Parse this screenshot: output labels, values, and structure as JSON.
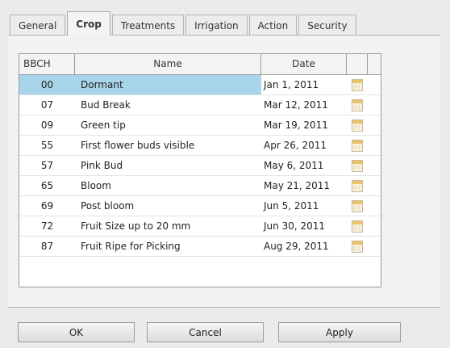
{
  "tabs": [
    {
      "label": "General",
      "active": false
    },
    {
      "label": "Crop",
      "active": true
    },
    {
      "label": "Treatments",
      "active": false
    },
    {
      "label": "Irrigation",
      "active": false
    },
    {
      "label": "Action",
      "active": false
    },
    {
      "label": "Security",
      "active": false
    }
  ],
  "table": {
    "headers": {
      "bbch": "BBCH",
      "name": "Name",
      "date": "Date"
    },
    "selected_row": 0,
    "rows": [
      {
        "bbch": "00",
        "name": "Dormant",
        "date": "Jan 1, 2011"
      },
      {
        "bbch": "07",
        "name": "Bud Break",
        "date": "Mar 12, 2011"
      },
      {
        "bbch": "09",
        "name": "Green tip",
        "date": "Mar 19, 2011"
      },
      {
        "bbch": "55",
        "name": "First flower buds visible",
        "date": "Apr 26, 2011"
      },
      {
        "bbch": "57",
        "name": "Pink Bud",
        "date": "May 6, 2011"
      },
      {
        "bbch": "65",
        "name": "Bloom",
        "date": "May 21, 2011"
      },
      {
        "bbch": "69",
        "name": "Post bloom",
        "date": "Jun 5, 2011"
      },
      {
        "bbch": "72",
        "name": "Fruit Size up to 20 mm",
        "date": "Jun 30, 2011"
      },
      {
        "bbch": "87",
        "name": "Fruit Ripe for Picking",
        "date": "Aug 29, 2011"
      }
    ],
    "date_icon": "calendar-icon"
  },
  "buttons": {
    "ok": "OK",
    "cancel": "Cancel",
    "apply": "Apply"
  },
  "colors": {
    "selection": "#a9d5ea",
    "calendar_icon": "#e8c46a"
  }
}
